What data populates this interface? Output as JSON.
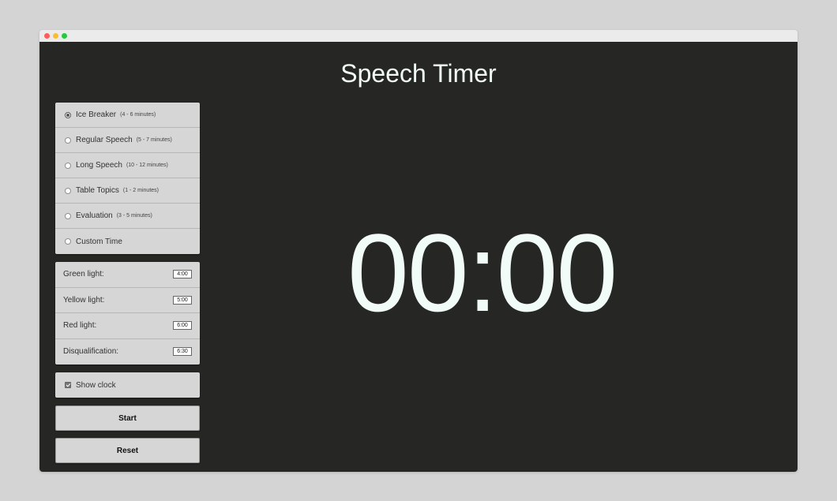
{
  "app": {
    "title": "Speech Timer"
  },
  "presets": [
    {
      "label": "Ice Breaker",
      "range": "(4 - 6 minutes)",
      "checked": true
    },
    {
      "label": "Regular Speech",
      "range": "(5 - 7 minutes)",
      "checked": false
    },
    {
      "label": "Long Speech",
      "range": "(10 - 12 minutes)",
      "checked": false
    },
    {
      "label": "Table Topics",
      "range": "(1 - 2 minutes)",
      "checked": false
    },
    {
      "label": "Evaluation",
      "range": "(3 - 5 minutes)",
      "checked": false
    },
    {
      "label": "Custom Time",
      "range": "",
      "checked": false
    }
  ],
  "lights": [
    {
      "label": "Green light:",
      "value": "4:00"
    },
    {
      "label": "Yellow light:",
      "value": "5:00"
    },
    {
      "label": "Red light:",
      "value": "6:00"
    },
    {
      "label": "Disqualification:",
      "value": "6:30"
    }
  ],
  "options": {
    "show_clock_label": "Show clock",
    "show_clock_checked": true
  },
  "buttons": {
    "start_label": "Start",
    "reset_label": "Reset"
  },
  "clock": {
    "display": "00:00"
  },
  "colors": {
    "background": "#262724",
    "clock_text": "#f1fbf7",
    "panel": "#d6d6d6"
  }
}
